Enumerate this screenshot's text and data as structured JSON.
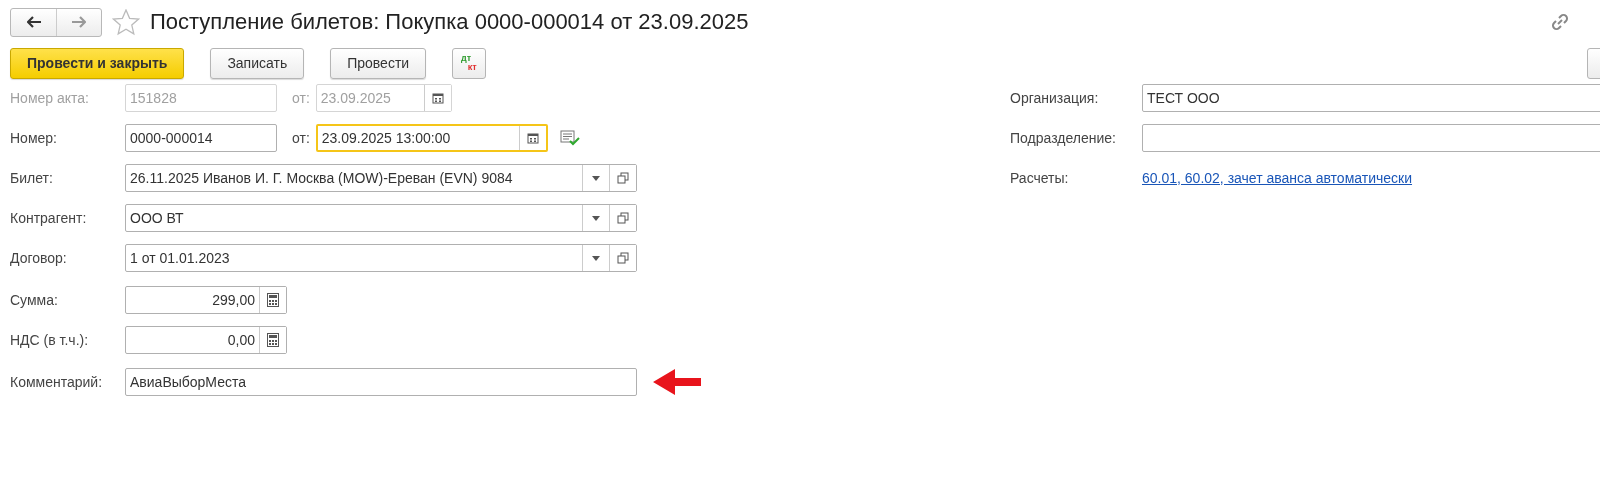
{
  "header": {
    "title": "Поступление билетов: Покупка 0000-000014 от 23.09.2025",
    "favorite": false
  },
  "toolbar": {
    "buttons": [
      {
        "label": "Провести и закрыть",
        "kind": "primary"
      },
      {
        "label": "Записать",
        "kind": "normal"
      },
      {
        "label": "Провести",
        "kind": "normal"
      }
    ],
    "dtkt": {
      "top": "дт",
      "bottom": "кт"
    }
  },
  "left_sections": [
    [
      {
        "kind": "number_date",
        "label": "Номер акта:",
        "value": "151828",
        "date_label": "от:",
        "date": "23.09.2025",
        "disabled": true,
        "focused": false,
        "posted": false
      },
      {
        "kind": "number_date",
        "label": "Номер:",
        "value": "0000-000014",
        "date_label": "от:",
        "date": "23.09.2025 13:00:00",
        "disabled": false,
        "focused": true,
        "posted": true
      },
      {
        "kind": "select",
        "label": "Билет:",
        "value": "26.11.2025 Иванов И. Г. Москва (MOW)-Ереван (EVN) 9084"
      },
      {
        "kind": "select",
        "label": "Контрагент:",
        "value": "ООО ВТ"
      },
      {
        "kind": "select",
        "label": "Договор:",
        "value": "1 от 01.01.2023"
      }
    ],
    [
      {
        "kind": "amount",
        "label": "Сумма:",
        "value": "299,00"
      },
      {
        "kind": "amount",
        "label": "НДС (в т.ч.):",
        "value": "0,00"
      }
    ],
    [
      {
        "kind": "text",
        "label": "Комментарий:",
        "value": "АвиаВыборМеста",
        "pointer": true
      }
    ]
  ],
  "right_rows": [
    {
      "kind": "text",
      "label": "Организация:",
      "value": "ТЕСТ ООО"
    },
    {
      "kind": "text",
      "label": "Подразделение:"
    },
    {
      "kind": "link",
      "label": "Расчеты:",
      "value": "60.01, 60.02, зачет аванса автоматически"
    }
  ]
}
